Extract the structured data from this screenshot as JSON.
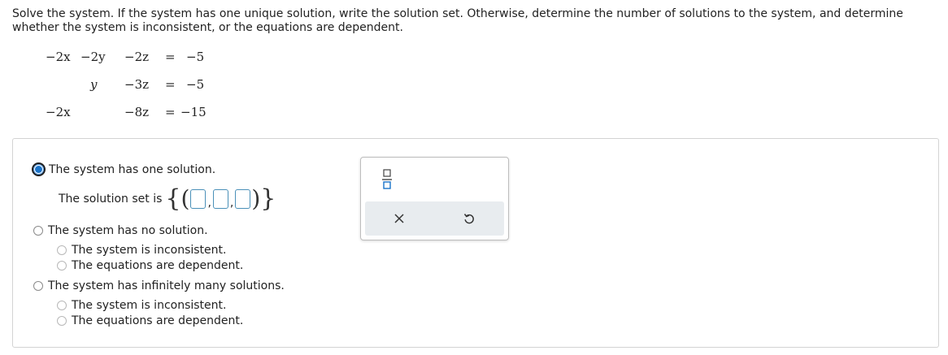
{
  "prompt": "Solve the system. If the system has one unique solution, write the solution set. Otherwise, determine the number of solutions to the system, and determine whether the system is inconsistent, or the equations are dependent.",
  "system": {
    "row1": {
      "x": "−2x",
      "y": "−2y",
      "z": "−2z",
      "eq": "=",
      "rhs": "−5"
    },
    "row2": {
      "y": "y",
      "z": "−3z",
      "eq": "=",
      "rhs": "−5"
    },
    "row3": {
      "x": "−2x",
      "z": "−8z",
      "eq": "=",
      "rhs": "−15"
    }
  },
  "options": {
    "one_solution": {
      "label": "The system has one solution.",
      "selected": true
    },
    "solution_set_label": "The solution set is",
    "solution_set": {
      "open_brace": "{",
      "open_paren": "(",
      "comma": ",",
      "close_paren": ")",
      "close_brace": "}",
      "values": [
        "",
        "",
        ""
      ]
    },
    "no_solution": {
      "label": "The system has no solution.",
      "sub": [
        "The system is inconsistent.",
        "The equations are dependent."
      ]
    },
    "infinite": {
      "label": "The system has infinitely many solutions.",
      "sub": [
        "The system is inconsistent.",
        "The equations are dependent."
      ]
    }
  },
  "palette": {
    "fraction_icon": "fraction-icon",
    "clear_icon": "close-icon",
    "reset_icon": "undo-icon",
    "accent": "#1a73c9",
    "toolbar_bg": "#e8ecef",
    "border": "#4a90b8"
  }
}
